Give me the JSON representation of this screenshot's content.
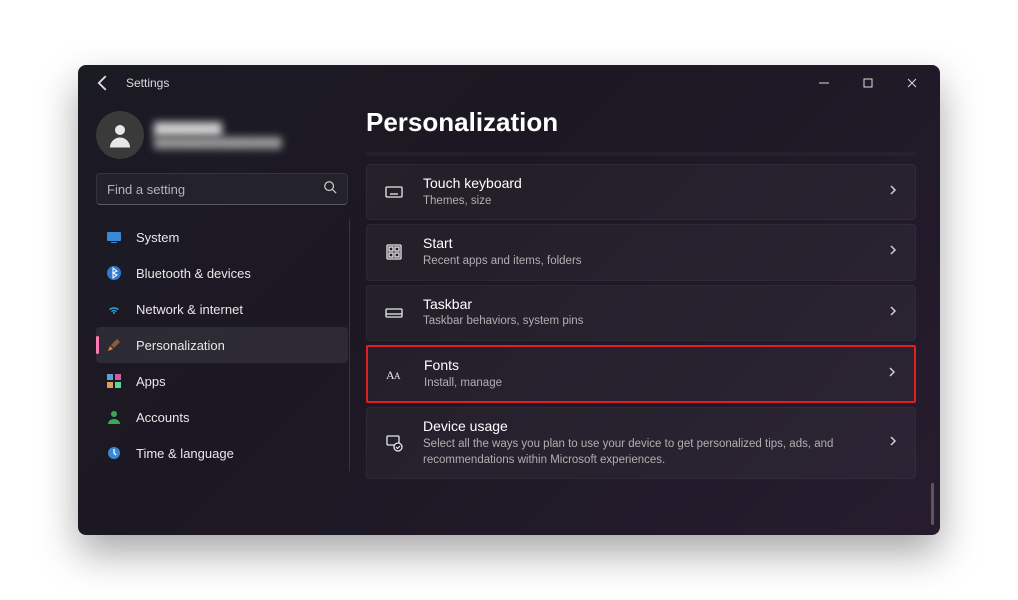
{
  "window": {
    "title": "Settings"
  },
  "profile": {
    "name": "████████",
    "email": "██████████████████"
  },
  "search": {
    "placeholder": "Find a setting"
  },
  "nav": [
    {
      "key": "system",
      "label": "System",
      "selected": false
    },
    {
      "key": "bluetooth",
      "label": "Bluetooth & devices",
      "selected": false
    },
    {
      "key": "network",
      "label": "Network & internet",
      "selected": false
    },
    {
      "key": "personalization",
      "label": "Personalization",
      "selected": true
    },
    {
      "key": "apps",
      "label": "Apps",
      "selected": false
    },
    {
      "key": "accounts",
      "label": "Accounts",
      "selected": false
    },
    {
      "key": "time",
      "label": "Time & language",
      "selected": false
    }
  ],
  "page": {
    "title": "Personalization"
  },
  "cards": [
    {
      "key": "touch-keyboard",
      "title": "Touch keyboard",
      "subtitle": "Themes, size",
      "highlight": false
    },
    {
      "key": "start",
      "title": "Start",
      "subtitle": "Recent apps and items, folders",
      "highlight": false
    },
    {
      "key": "taskbar",
      "title": "Taskbar",
      "subtitle": "Taskbar behaviors, system pins",
      "highlight": false
    },
    {
      "key": "fonts",
      "title": "Fonts",
      "subtitle": "Install, manage",
      "highlight": true
    },
    {
      "key": "device-usage",
      "title": "Device usage",
      "subtitle": "Select all the ways you plan to use your device to get personalized tips, ads, and recommendations within Microsoft experiences.",
      "highlight": false
    }
  ]
}
